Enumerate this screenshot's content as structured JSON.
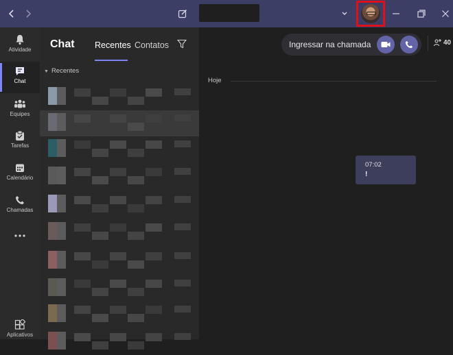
{
  "titlebar": {
    "back_icon": "chevron-left-icon",
    "forward_icon": "chevron-right-icon",
    "compose_icon": "compose-icon",
    "search_placeholder": "",
    "more_icon": "chevron-down-icon",
    "window_controls": [
      "minimize",
      "restore",
      "close"
    ],
    "avatar_highlight_color": "#e0101a"
  },
  "rail": {
    "items": [
      {
        "label": "Atividade",
        "icon": "bell-icon"
      },
      {
        "label": "Chat",
        "icon": "chat-icon",
        "active": true
      },
      {
        "label": "Equipes",
        "icon": "teams-icon"
      },
      {
        "label": "Tarefas",
        "icon": "tasks-icon"
      },
      {
        "label": "Calendário",
        "icon": "calendar-icon"
      },
      {
        "label": "Chamadas",
        "icon": "phone-icon"
      },
      {
        "label": "...",
        "icon": "more-icon"
      },
      {
        "label": "Aplicativos",
        "icon": "apps-icon"
      }
    ]
  },
  "chat_list": {
    "title": "Chat",
    "tabs": [
      "Recentes",
      "Contatos"
    ],
    "active_tab": "Recentes",
    "section": "Recentes"
  },
  "main": {
    "join_call_label": "Ingressar na chamada",
    "participants_count": "40",
    "day_label": "Hoje",
    "message": {
      "time": "07:02",
      "text": "!"
    }
  },
  "colors": {
    "accent": "#7f85f5",
    "titlebar": "#3d3e66",
    "bubble": "#3d3e5c",
    "call_button": "#6264a7"
  }
}
